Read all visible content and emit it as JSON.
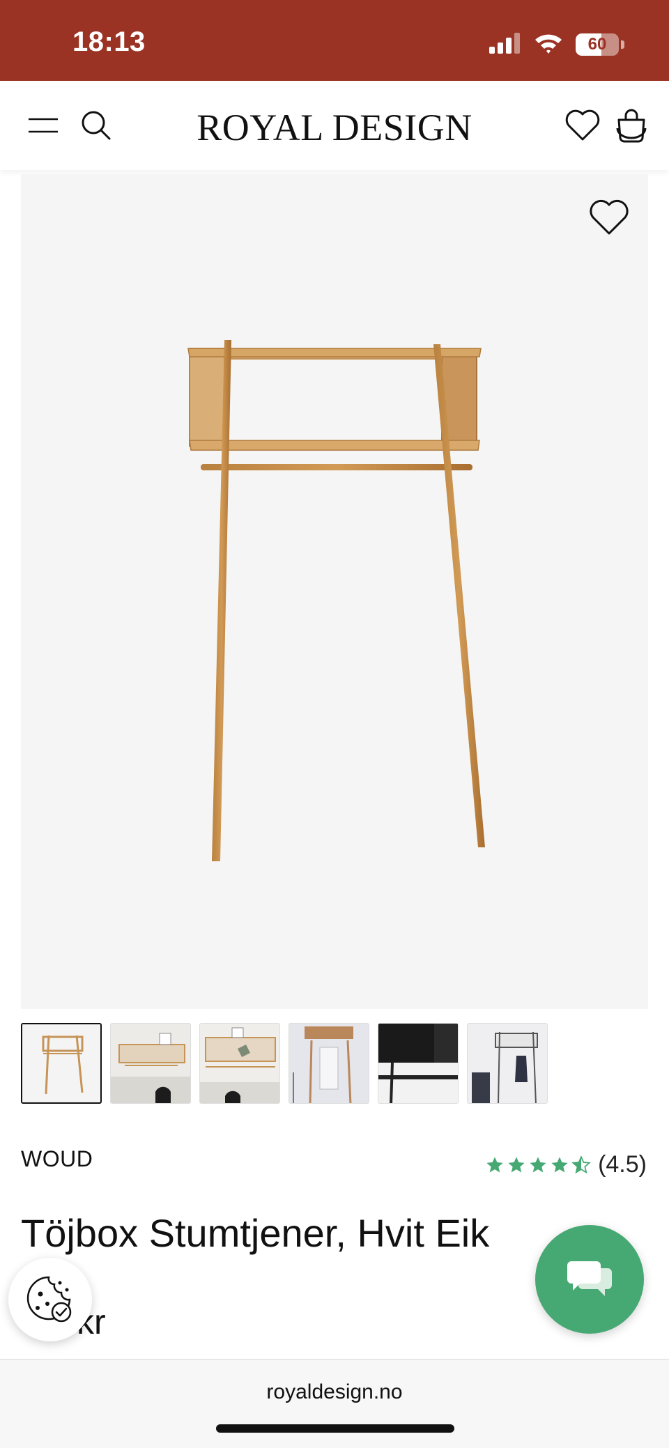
{
  "status_bar": {
    "time": "18:13",
    "battery_percent": "60",
    "signal_icon": "cellular-signal-icon",
    "wifi_icon": "wifi-icon",
    "background_color": "#9b3324"
  },
  "header": {
    "logo": "ROYAL DESIGN",
    "menu_icon": "hamburger-menu-icon",
    "search_icon": "search-icon",
    "wishlist_icon": "heart-icon",
    "cart_icon": "shopping-bag-icon"
  },
  "gallery": {
    "favorite_icon": "heart-outline-icon",
    "thumbnail_count": 6,
    "active_thumbnail": 1
  },
  "product": {
    "brand": "WOUD",
    "rating_stars": 4.5,
    "rating_text": "(4.5)",
    "title": "Töjbox Stumtjener, Hvit Eik",
    "price_visible": "kr"
  },
  "floating": {
    "cookie_icon": "cookie-settings-icon",
    "chat_icon": "chat-bubbles-icon",
    "chat_color": "#46a872"
  },
  "browser": {
    "url": "royaldesign.no"
  }
}
